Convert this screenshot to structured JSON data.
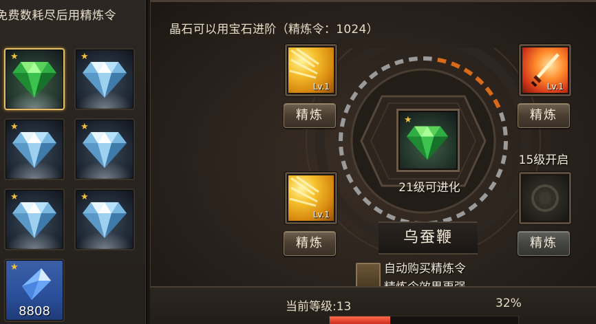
{
  "left_panel": {
    "title": "免费数耗尽后用精炼令",
    "slots": [
      {
        "type": "green-gem",
        "star": "★",
        "selected": true
      },
      {
        "type": "blue-gem",
        "star": "★"
      },
      {
        "type": "blue-gem",
        "star": "★"
      },
      {
        "type": "blue-gem",
        "star": "★"
      },
      {
        "type": "blue-gem",
        "star": "★"
      },
      {
        "type": "blue-gem",
        "star": "★"
      },
      {
        "type": "blue-crystal",
        "star": "★",
        "count": "8808"
      }
    ]
  },
  "main": {
    "info_text": "晶石可以用宝石进阶（精炼令：1024）",
    "skills": [
      {
        "id": "top-left",
        "icon": "gold-skill-icon",
        "level": "Lv.1",
        "button": "精炼"
      },
      {
        "id": "bottom-left",
        "icon": "gold-skill-icon",
        "level": "Lv.1",
        "button": "精炼"
      },
      {
        "id": "top-right",
        "icon": "fire-sword-skill-icon",
        "level": "Lv.1",
        "button": "精炼"
      },
      {
        "id": "bottom-right",
        "icon": "locked-skill-icon",
        "level": "",
        "button": "精炼"
      }
    ],
    "center_gem_star": "★",
    "evolve_text": "21级可进化",
    "unlock_text": "15级开启",
    "item_name": "乌蚕鞭",
    "auto_buy_label": "自动购买精炼令",
    "auto_buy_effect": "精炼令效果更强",
    "current_level": "当前等级:13",
    "progress_percent": "32%",
    "progress_value": 0.32
  },
  "colors": {
    "accent_gold": "#e6c16a",
    "progress_red": "#c8281a",
    "ring_orange": "#d86a1a",
    "ring_gray": "#9a9a9a"
  }
}
